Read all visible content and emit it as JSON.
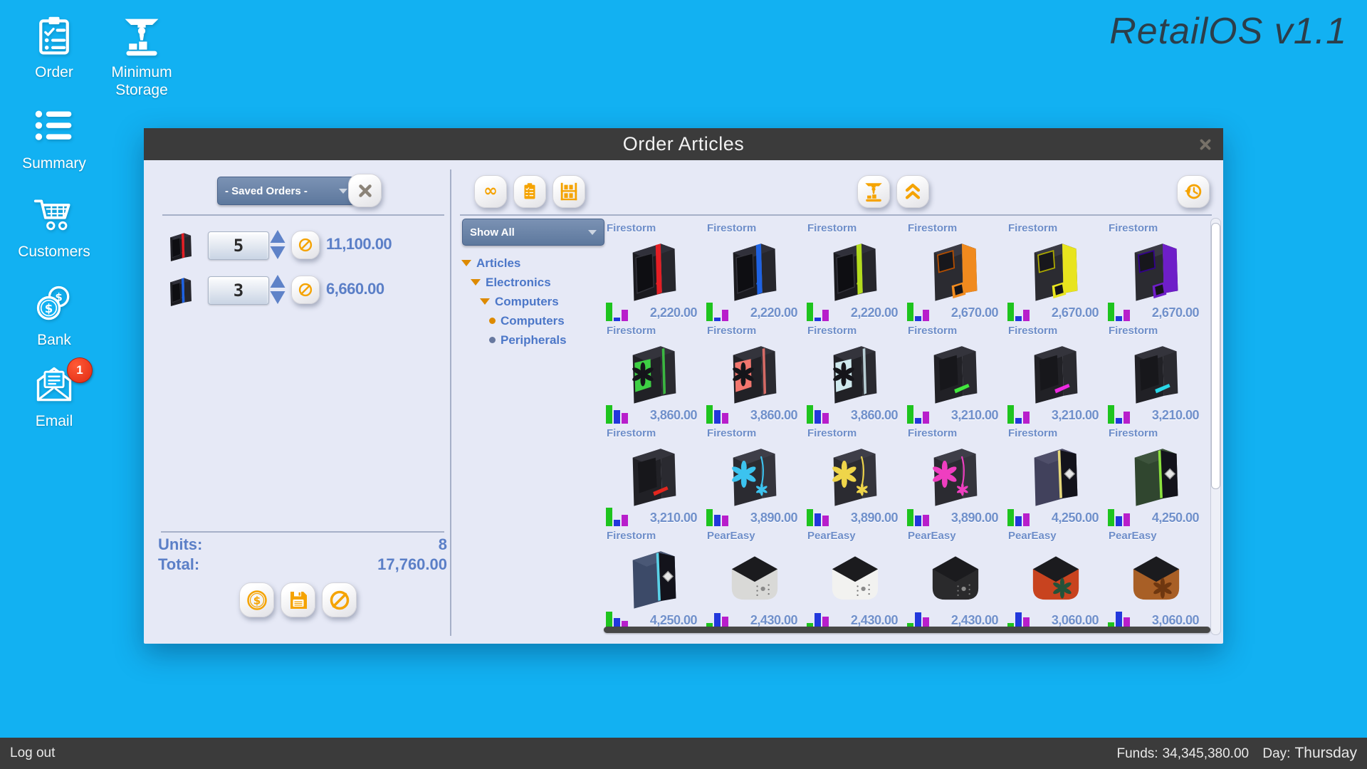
{
  "app": {
    "title": "RetailOS v1.1"
  },
  "colors": {
    "background": "#12b1f2",
    "bar_dark": "#3b3b3b",
    "panel": "#e6e9f6",
    "accent_orange": "#f5a300",
    "blue_text": "#5b7fc7",
    "bar_green": "#1ec41e",
    "bar_blue": "#2238dc",
    "bar_purple": "#b81ecb"
  },
  "sidebar": {
    "items": [
      {
        "id": "order",
        "label": "Order",
        "icon": "clipboard-check-icon"
      },
      {
        "id": "minimum-storage",
        "label": "Minimum Storage",
        "icon": "storage-machine-icon"
      },
      {
        "id": "summary",
        "label": "Summary",
        "icon": "summary-list-icon"
      },
      {
        "id": "customers",
        "label": "Customers",
        "icon": "shopping-cart-icon"
      },
      {
        "id": "bank",
        "label": "Bank",
        "icon": "coins-icon"
      },
      {
        "id": "email",
        "label": "Email",
        "icon": "envelope-icon",
        "badge": "1"
      }
    ]
  },
  "statusbar": {
    "logout_label": "Log out",
    "funds_label": "Funds:",
    "funds_value": "34,345,380.00",
    "day_label": "Day:",
    "day_value": "Thursday"
  },
  "dialog": {
    "title": "Order Articles",
    "order_panel": {
      "saved_orders_label": "- Saved Orders -",
      "rows": [
        {
          "qty": "5",
          "price": "11,100.00",
          "thumb_style": "trim",
          "thumb_accent": "#e31e24"
        },
        {
          "qty": "3",
          "price": "6,660.00",
          "thumb_style": "trim",
          "thumb_accent": "#1e62e3"
        }
      ],
      "units_label": "Units:",
      "units_value": "8",
      "total_label": "Total:",
      "total_value": "17,760.00",
      "action_icons": [
        "coin-dollar-icon",
        "save-floppy-icon",
        "cancel-slash-icon"
      ]
    },
    "catalog_panel": {
      "filter_label": "Show All",
      "toolbar_left": [
        "infinity-icon",
        "clipboard-list-icon",
        "shelf-icon"
      ],
      "toolbar_mid": [
        "storage-machine-icon",
        "chevrons-up-icon"
      ],
      "toolbar_far": [
        "history-icon"
      ],
      "tree": [
        {
          "label": "Articles",
          "indent": 0,
          "marker": "expanded"
        },
        {
          "label": "Electronics",
          "indent": 1,
          "marker": "expanded"
        },
        {
          "label": "Computers",
          "indent": 2,
          "marker": "expanded"
        },
        {
          "label": "Computers",
          "indent": 3,
          "marker": "leaf-selected"
        },
        {
          "label": "Peripherals",
          "indent": 3,
          "marker": "leaf"
        }
      ],
      "products": [
        {
          "name": "Firestorm",
          "price": "2,220.00",
          "style": "trim",
          "accent": "#e31e24",
          "bars": [
            0.95,
            0.2,
            0.6
          ]
        },
        {
          "name": "Firestorm",
          "price": "2,220.00",
          "style": "trim",
          "accent": "#1e62e3",
          "bars": [
            0.95,
            0.2,
            0.6
          ]
        },
        {
          "name": "Firestorm",
          "price": "2,220.00",
          "style": "trim",
          "accent": "#b4dc1e",
          "bars": [
            0.95,
            0.2,
            0.6
          ]
        },
        {
          "name": "Firestorm",
          "price": "2,670.00",
          "style": "angular",
          "accent": "#f08a1e",
          "bars": [
            0.95,
            0.25,
            0.6
          ]
        },
        {
          "name": "Firestorm",
          "price": "2,670.00",
          "style": "angular",
          "accent": "#e8e41e",
          "bars": [
            0.95,
            0.25,
            0.6
          ]
        },
        {
          "name": "Firestorm",
          "price": "2,670.00",
          "style": "angular",
          "accent": "#6e1ec8",
          "bars": [
            0.95,
            0.25,
            0.6
          ]
        },
        {
          "name": "Firestorm",
          "price": "3,860.00",
          "style": "fan",
          "accent": "#3ecf44",
          "bars": [
            0.95,
            0.7,
            0.55
          ]
        },
        {
          "name": "Firestorm",
          "price": "3,860.00",
          "style": "fan",
          "accent": "#f2766e",
          "bars": [
            0.95,
            0.7,
            0.55
          ]
        },
        {
          "name": "Firestorm",
          "price": "3,860.00",
          "style": "fan",
          "accent": "#cfe9ee",
          "bars": [
            0.95,
            0.7,
            0.55
          ]
        },
        {
          "name": "Firestorm",
          "price": "3,210.00",
          "style": "stripe",
          "accent": "#42e83e",
          "bars": [
            0.95,
            0.3,
            0.62
          ]
        },
        {
          "name": "Firestorm",
          "price": "3,210.00",
          "style": "stripe",
          "accent": "#ee2ae2",
          "bars": [
            0.95,
            0.3,
            0.62
          ]
        },
        {
          "name": "Firestorm",
          "price": "3,210.00",
          "style": "stripe",
          "accent": "#2ad8e8",
          "bars": [
            0.95,
            0.3,
            0.62
          ]
        },
        {
          "name": "Firestorm",
          "price": "3,210.00",
          "style": "stripe",
          "accent": "#e3261e",
          "bars": [
            0.95,
            0.35,
            0.6
          ]
        },
        {
          "name": "Firestorm",
          "price": "3,890.00",
          "style": "flower",
          "accent": "#3cc3ef",
          "bars": [
            0.9,
            0.6,
            0.55
          ]
        },
        {
          "name": "Firestorm",
          "price": "3,890.00",
          "style": "flower",
          "accent": "#efd54a",
          "bars": [
            0.9,
            0.65,
            0.55
          ]
        },
        {
          "name": "Firestorm",
          "price": "3,890.00",
          "style": "flower",
          "accent": "#ef3ec0",
          "bars": [
            0.9,
            0.55,
            0.6
          ]
        },
        {
          "name": "Firestorm",
          "price": "4,250.00",
          "style": "diamond",
          "body": "#41415c",
          "accent": "#e5d77a",
          "bars": [
            0.9,
            0.5,
            0.68
          ]
        },
        {
          "name": "Firestorm",
          "price": "4,250.00",
          "style": "diamond",
          "body": "#30462f",
          "accent": "#8ce23e",
          "bars": [
            0.9,
            0.5,
            0.68
          ]
        },
        {
          "name": "Firestorm",
          "price": "4,250.00",
          "style": "diamond",
          "body": "#3c4a68",
          "accent": "#5ad2e8",
          "bars": [
            0.9,
            0.55,
            0.4
          ]
        },
        {
          "name": "PearEasy",
          "price": "2,430.00",
          "style": "cube",
          "body": "#d9d9d7",
          "bars": [
            0.28,
            0.8,
            0.62
          ]
        },
        {
          "name": "PearEasy",
          "price": "2,430.00",
          "style": "cube",
          "body": "#f2f2f0",
          "bars": [
            0.28,
            0.8,
            0.62
          ]
        },
        {
          "name": "PearEasy",
          "price": "2,430.00",
          "style": "cube",
          "body": "#2a2a2c",
          "bars": [
            0.3,
            0.85,
            0.6
          ]
        },
        {
          "name": "PearEasy",
          "price": "3,060.00",
          "style": "cube",
          "body": "#c8431f",
          "emblem": "#245239",
          "bars": [
            0.3,
            0.85,
            0.6
          ]
        },
        {
          "name": "PearEasy",
          "price": "3,060.00",
          "style": "cube",
          "body": "#a85f26",
          "emblem": "#6e3710",
          "bars": [
            0.35,
            0.9,
            0.6
          ]
        }
      ]
    }
  }
}
